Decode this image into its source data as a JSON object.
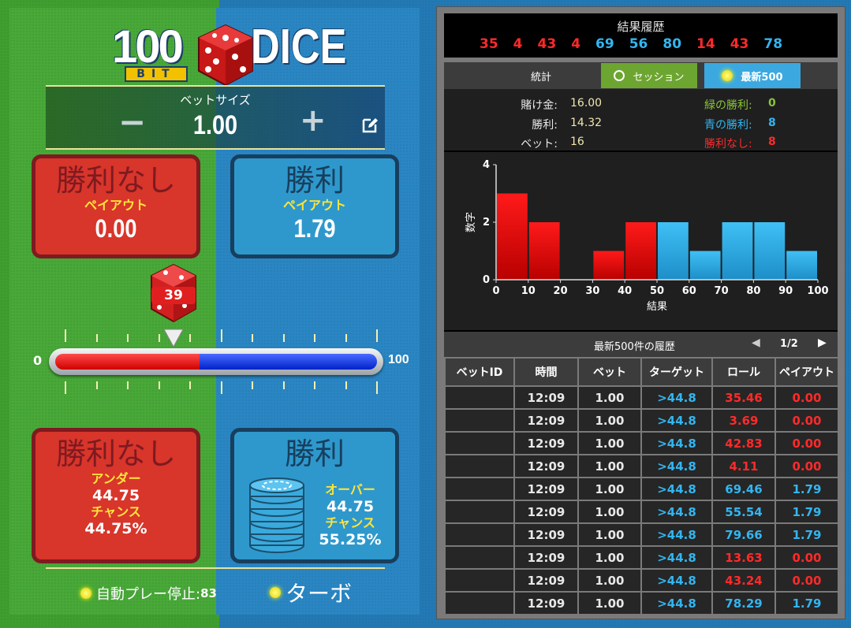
{
  "game": {
    "logo": {
      "number": "100",
      "bit": "BIT",
      "word": "DICE"
    },
    "bet": {
      "label": "ベットサイズ",
      "value": "1.00",
      "minus": "−",
      "plus": "+"
    },
    "top_cards": {
      "red": {
        "title": "勝利なし",
        "sub": "ペイアウト",
        "value": "0.00"
      },
      "blue": {
        "title": "勝利",
        "sub": "ペイアウト",
        "value": "1.79"
      }
    },
    "slider": {
      "min": "0",
      "max": "100",
      "marker": "39",
      "split_fraction": 0.4475
    },
    "bottom_cards": {
      "red": {
        "title": "勝利なし",
        "l1": "アンダー",
        "v1": "44.75",
        "l2": "チャンス",
        "v2": "44.75%"
      },
      "blue": {
        "title": "勝利",
        "l1": "オーバー",
        "v1": "44.75",
        "l2": "チャンス",
        "v2": "55.25%"
      }
    },
    "footer": {
      "autoplay": "自動プレー停止:",
      "autoplay_count": "83",
      "turbo": "ターボ"
    }
  },
  "panel": {
    "history": {
      "title": "結果履歴",
      "results": [
        {
          "v": "35",
          "c": "#ff2a2a"
        },
        {
          "v": "4",
          "c": "#ff2a2a"
        },
        {
          "v": "43",
          "c": "#ff2a2a"
        },
        {
          "v": "4",
          "c": "#ff2a2a"
        },
        {
          "v": "69",
          "c": "#33b5f0"
        },
        {
          "v": "56",
          "c": "#33b5f0"
        },
        {
          "v": "80",
          "c": "#33b5f0"
        },
        {
          "v": "14",
          "c": "#ff2a2a"
        },
        {
          "v": "43",
          "c": "#ff2a2a"
        },
        {
          "v": "78",
          "c": "#33b5f0"
        }
      ]
    },
    "stats": {
      "label": "統計",
      "session_button": "セッション",
      "latest_button": "最新500",
      "wager_label": "賭け金:",
      "wager": "16.00",
      "wins_label": "勝利:",
      "wins": "14.32",
      "bets_label": "ベット:",
      "bets": "16",
      "green_label": "緑の勝利:",
      "green": "0",
      "blue_label": "青の勝利:",
      "blue": "8",
      "none_label": "勝利なし:",
      "none": "8"
    },
    "table_header": {
      "title": "最新500件の履歴",
      "page": "1/2",
      "prev": "◀",
      "next": "▶"
    },
    "columns": [
      "ベットID",
      "時間",
      "ベット",
      "ターゲット",
      "ロール",
      "ペイアウト"
    ],
    "rows": [
      {
        "id": "",
        "time": "12:09",
        "bet": "1.00",
        "target": ">44.8",
        "roll": "35.46",
        "payout": "0.00",
        "win": false
      },
      {
        "id": "",
        "time": "12:09",
        "bet": "1.00",
        "target": ">44.8",
        "roll": "3.69",
        "payout": "0.00",
        "win": false
      },
      {
        "id": "",
        "time": "12:09",
        "bet": "1.00",
        "target": ">44.8",
        "roll": "42.83",
        "payout": "0.00",
        "win": false
      },
      {
        "id": "",
        "time": "12:09",
        "bet": "1.00",
        "target": ">44.8",
        "roll": "4.11",
        "payout": "0.00",
        "win": false
      },
      {
        "id": "",
        "time": "12:09",
        "bet": "1.00",
        "target": ">44.8",
        "roll": "69.46",
        "payout": "1.79",
        "win": true
      },
      {
        "id": "",
        "time": "12:09",
        "bet": "1.00",
        "target": ">44.8",
        "roll": "55.54",
        "payout": "1.79",
        "win": true
      },
      {
        "id": "",
        "time": "12:09",
        "bet": "1.00",
        "target": ">44.8",
        "roll": "79.66",
        "payout": "1.79",
        "win": true
      },
      {
        "id": "",
        "time": "12:09",
        "bet": "1.00",
        "target": ">44.8",
        "roll": "13.63",
        "payout": "0.00",
        "win": false
      },
      {
        "id": "",
        "time": "12:09",
        "bet": "1.00",
        "target": ">44.8",
        "roll": "43.24",
        "payout": "0.00",
        "win": false
      },
      {
        "id": "",
        "time": "12:09",
        "bet": "1.00",
        "target": ">44.8",
        "roll": "78.29",
        "payout": "1.79",
        "win": true
      }
    ],
    "colors": {
      "lose": "#ff2a2a",
      "win": "#33b5f0",
      "green": "#8ac43a",
      "label": "#e8e8e8",
      "value": "#f0e6b0"
    }
  },
  "chart_data": {
    "type": "bar",
    "x": [
      0,
      10,
      20,
      30,
      40,
      50,
      60,
      70,
      80,
      90,
      100
    ],
    "bins": [
      {
        "from": 0,
        "to": 10,
        "value": 3,
        "color": "red"
      },
      {
        "from": 10,
        "to": 20,
        "value": 2,
        "color": "red"
      },
      {
        "from": 20,
        "to": 30,
        "value": 0,
        "color": "red"
      },
      {
        "from": 30,
        "to": 40,
        "value": 1,
        "color": "red"
      },
      {
        "from": 40,
        "to": 50,
        "value": 2,
        "color": "red"
      },
      {
        "from": 50,
        "to": 60,
        "value": 2,
        "color": "blue"
      },
      {
        "from": 60,
        "to": 70,
        "value": 1,
        "color": "blue"
      },
      {
        "from": 70,
        "to": 80,
        "value": 2,
        "color": "blue"
      },
      {
        "from": 80,
        "to": 90,
        "value": 2,
        "color": "blue"
      },
      {
        "from": 90,
        "to": 100,
        "value": 1,
        "color": "blue"
      }
    ],
    "xlabel": "結果",
    "ylabel": "数字",
    "yticks": [
      0,
      2,
      4
    ],
    "ylim": [
      0,
      4
    ],
    "xlim": [
      0,
      100
    ]
  }
}
